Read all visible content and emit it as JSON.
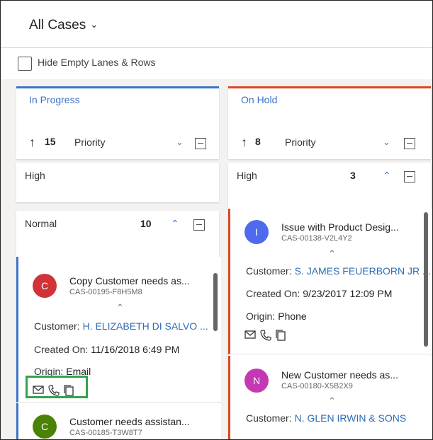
{
  "header": {
    "view_title": "All Cases",
    "dropdown_icon": "chevron-down-icon"
  },
  "filter": {
    "hide_empty_label": "Hide Empty Lanes & Rows",
    "checked": false
  },
  "colors": {
    "in_progress_accent": "#3b73c8",
    "on_hold_accent": "#d9471f",
    "link": "#2f6db5",
    "highlight": "#2ea44f"
  },
  "lanes": [
    {
      "title": "In Progress",
      "sort_count": "15",
      "sort_field": "Priority",
      "groups": [
        {
          "name": "High",
          "count": ""
        },
        {
          "name": "Normal",
          "count": "10",
          "cards": [
            {
              "avatar_letter": "C",
              "avatar_color": "#d13438",
              "title": "Copy Customer needs as...",
              "id": "CAS-00195-F8H5M8",
              "customer_label": "Customer:",
              "customer_value": "H. ELIZABETH DI SALVO ...",
              "created_label": "Created On:",
              "created_value": "11/16/2018 6:49 PM",
              "origin_label": "Origin:",
              "origin_value": "Email"
            },
            {
              "avatar_letter": "C",
              "avatar_color": "#498205",
              "title": "Customer needs assistan...",
              "id": "CAS-00185-T3W8T7"
            }
          ]
        }
      ]
    },
    {
      "title": "On Hold",
      "sort_count": "8",
      "sort_field": "Priority",
      "groups": [
        {
          "name": "High",
          "count": "3",
          "cards": [
            {
              "avatar_letter": "I",
              "avatar_color": "#4f6bed",
              "title": "Issue with Product Desig...",
              "id": "CAS-00138-V2L4Y2",
              "customer_label": "Customer:",
              "customer_value": "S. JAMES FEUERBORN JR ...",
              "created_label": "Created On:",
              "created_value": "9/23/2017 12:09 PM",
              "origin_label": "Origin:",
              "origin_value": "Phone"
            },
            {
              "avatar_letter": "N",
              "avatar_color": "#c239b3",
              "title": "New Customer needs as...",
              "id": "CAS-00180-X5B2X9",
              "customer_label": "Customer:",
              "customer_value": "N. GLEN IRWIN & SONS"
            }
          ]
        }
      ]
    }
  ],
  "icons": {
    "sort": "arrow-up-icon",
    "email": "mail-icon",
    "phone": "phone-icon",
    "copy": "copy-icon",
    "minimize": "minimize-icon",
    "collapse": "chevron-up-icon"
  }
}
